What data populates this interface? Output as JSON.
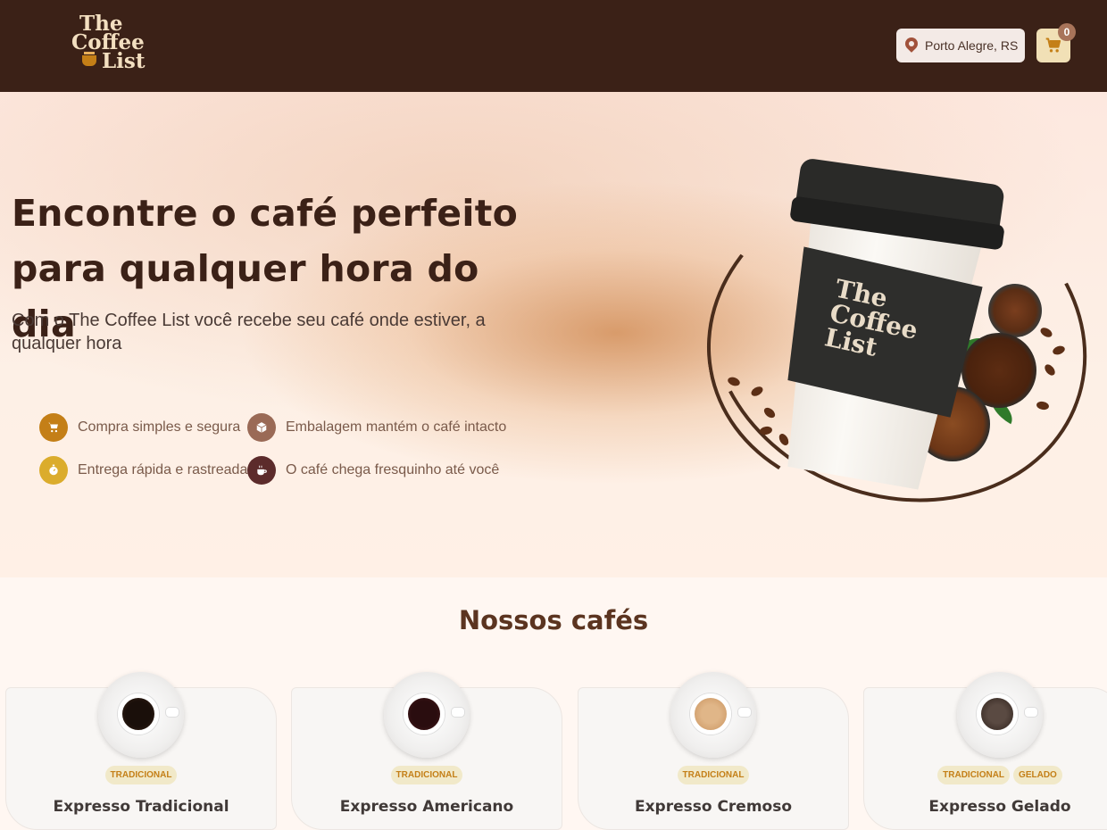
{
  "header": {
    "logo": {
      "line1": "The",
      "line2": "Coffee",
      "line3": "List"
    },
    "location": "Porto Alegre, RS",
    "cart_count": "0"
  },
  "hero": {
    "title": "Encontre o café perfeito para qualquer hora do dia",
    "subtitle": "Com o The Coffee List você recebe seu café onde estiver, a qualquer hora",
    "features": [
      {
        "label": "Compra simples e segura",
        "icon": "cart-icon",
        "color": "#C47F17"
      },
      {
        "label": "Embalagem mantém o café intacto",
        "icon": "package-icon",
        "color": "#9A6A56"
      },
      {
        "label": "Entrega rápida e rastreada",
        "icon": "timer-icon",
        "color": "#DBAC2C"
      },
      {
        "label": "O café chega fresquinho até você",
        "icon": "coffee-icon",
        "color": "#5C2B2B"
      }
    ],
    "cup_brand": "The Coffee List"
  },
  "products": {
    "title": "Nossos cafés",
    "items": [
      {
        "name": "Expresso Tradicional",
        "tags": [
          "TRADICIONAL"
        ],
        "coffee_color": "#1a0f0a"
      },
      {
        "name": "Expresso Americano",
        "tags": [
          "TRADICIONAL"
        ],
        "coffee_color": "#2a0d0f"
      },
      {
        "name": "Expresso Cremoso",
        "tags": [
          "TRADICIONAL"
        ],
        "coffee_color": "#d9a878"
      },
      {
        "name": "Expresso Gelado",
        "tags": [
          "TRADICIONAL",
          "GELADO"
        ],
        "coffee_color": "#4a3a34"
      }
    ]
  }
}
